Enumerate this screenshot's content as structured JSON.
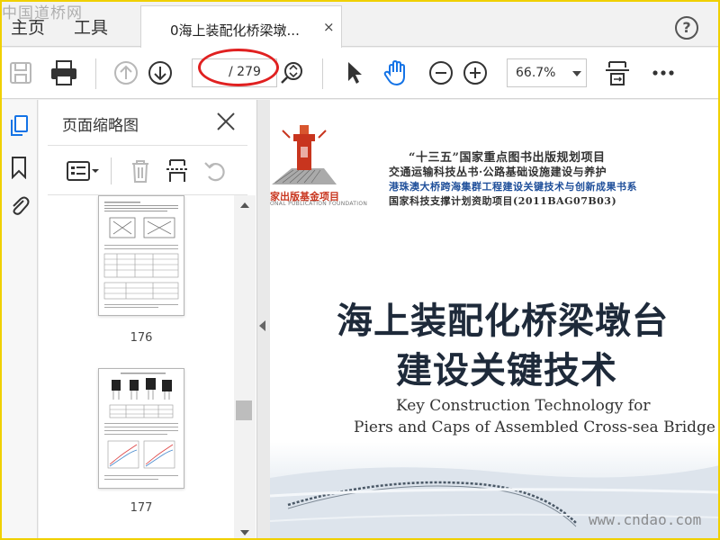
{
  "watermark_top": "中国道桥网",
  "watermark_bottom": "www.cndao.com",
  "menu": {
    "home": "主页",
    "tools": "工具"
  },
  "tab": {
    "label": "0海上装配化桥梁墩...",
    "close": "×"
  },
  "help": "?",
  "toolbar": {
    "page_current": "",
    "page_total": "/ 279",
    "zoom": "66.7%"
  },
  "panel": {
    "title": "页面缩略图",
    "close": "×"
  },
  "thumbnails": [
    {
      "number": "176"
    },
    {
      "number": "177"
    }
  ],
  "document": {
    "project_line1": "“十三五”国家重点图书出版规划项目",
    "project_line2": "交通运输科技丛书·公路基础设施建设与养护",
    "project_line3": "港珠澳大桥跨海集群工程建设关键技术与创新成果书系",
    "project_line4": "国家科技支撑计划资助项目(2011BAG07B03)",
    "fund_cn": "家出版基金项目",
    "fund_en": "ONAL PUBLICATION FOUNDATION",
    "title_line1": "海上装配化桥梁墩台",
    "title_line2": "建设关键技术",
    "subtitle_line1": "Key Construction Technology for",
    "subtitle_line2": "Piers and Caps of Assembled Cross-sea Bridge"
  },
  "colors": {
    "accent_blue": "#1473e6",
    "highlight_red": "#e02020",
    "frame_yellow": "#f0d000",
    "title_navy": "#1e2a3a"
  },
  "icons": [
    "save-icon",
    "print-icon",
    "prev-page-icon",
    "next-page-icon",
    "select-tool-icon",
    "hand-tool-icon",
    "zoom-out-icon",
    "zoom-in-icon",
    "fit-page-icon",
    "more-icon",
    "page-thumbnails-icon",
    "bookmark-icon",
    "attachment-icon",
    "options-icon",
    "delete-icon",
    "insert-page-icon",
    "rotate-icon"
  ]
}
